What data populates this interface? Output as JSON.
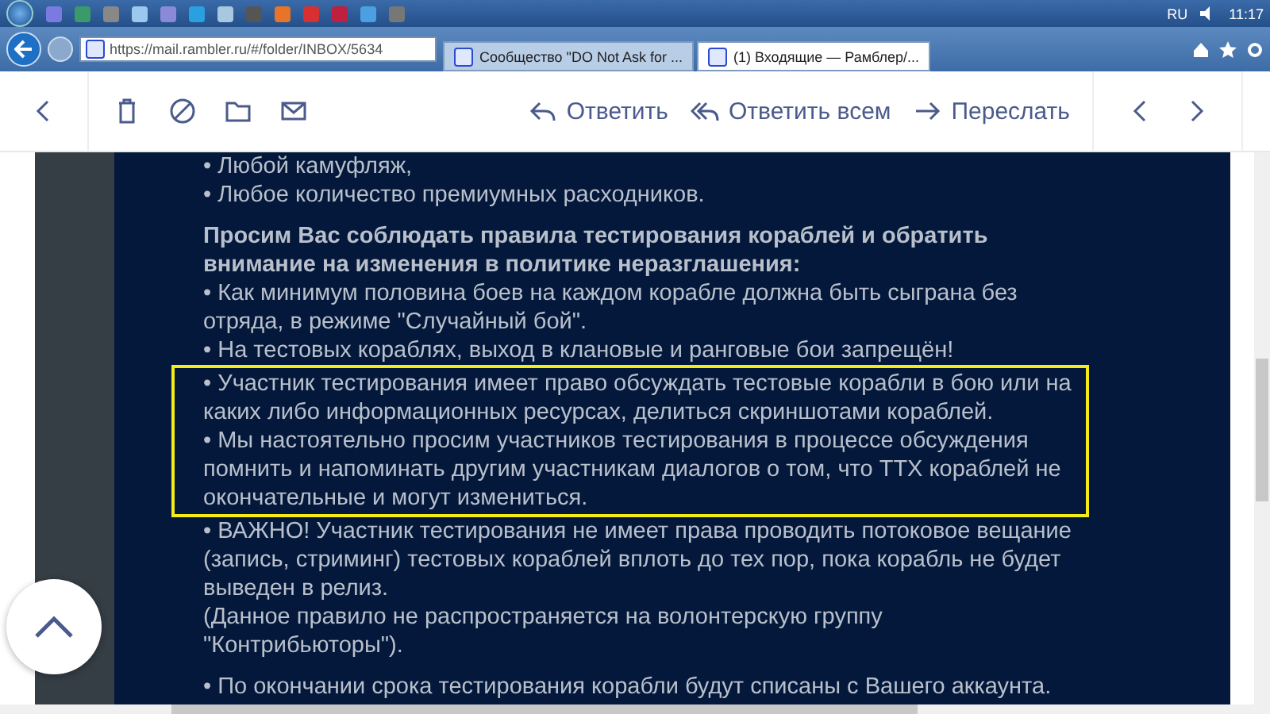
{
  "taskbar": {
    "language": "RU",
    "time": "11:17"
  },
  "browser": {
    "address": "https://mail.rambler.ru/#/folder/INBOX/5634",
    "tabs": [
      {
        "label": "Сообщество \"DO Not Ask for ...",
        "selected": false
      },
      {
        "label": "(1) Входящие — Рамблер/...",
        "selected": true
      }
    ]
  },
  "toolbar": {
    "actions": [
      {
        "kind": "reply",
        "label": "Ответить"
      },
      {
        "kind": "reply_all",
        "label": "Ответить всем"
      },
      {
        "kind": "forward",
        "label": "Переслать"
      }
    ]
  },
  "message": {
    "sections": [
      {
        "items": [
          {
            "kind": "bullet",
            "text": "• Любой камуфляж,",
            "highlighted": false
          },
          {
            "kind": "bullet",
            "text": "• Любое количество премиумных расходников.",
            "highlighted": false
          }
        ]
      },
      {
        "items": [
          {
            "kind": "heading",
            "text": "Просим Вас соблюдать правила тестирования кораблей и обратить внимание на изменения в политике неразглашения:",
            "highlighted": false
          },
          {
            "kind": "bullet",
            "text": "• Как минимум половина боев на каждом корабле должна быть сыграна без отряда, в режиме \"Случайный бой\".",
            "highlighted": false
          },
          {
            "kind": "bullet",
            "text": "• На тестовых кораблях, выход в клановые и ранговые бои запрещён!",
            "highlighted": false
          },
          {
            "kind": "bullet",
            "text": "• Участник тестирования имеет право обсуждать тестовые корабли в бою или на каких либо информационных ресурсах, делиться скриншотами кораблей.",
            "highlighted": true
          },
          {
            "kind": "bullet",
            "text": "• Мы настоятельно просим участников тестирования в процессе обсуждения помнить и напоминать другим участникам диалогов о том, что ТТХ кораблей не окончательные и могут измениться.",
            "highlighted": true
          },
          {
            "kind": "bullet",
            "text": "• ВАЖНО! Участник тестирования не имеет права проводить потоковое вещание (запись, стриминг) тестовых кораблей вплоть до тех пор, пока корабль не будет выведен в релиз.",
            "highlighted": false
          },
          {
            "kind": "bullet",
            "text": "(Данное правило не распространяется на волонтерскую группу \"Контрибьюторы\").",
            "highlighted": false
          }
        ]
      },
      {
        "items": [
          {
            "kind": "bullet",
            "text": "• По окончании срока тестирования корабли будут списаны с Вашего аккаунта.",
            "highlighted": false
          }
        ]
      }
    ]
  }
}
